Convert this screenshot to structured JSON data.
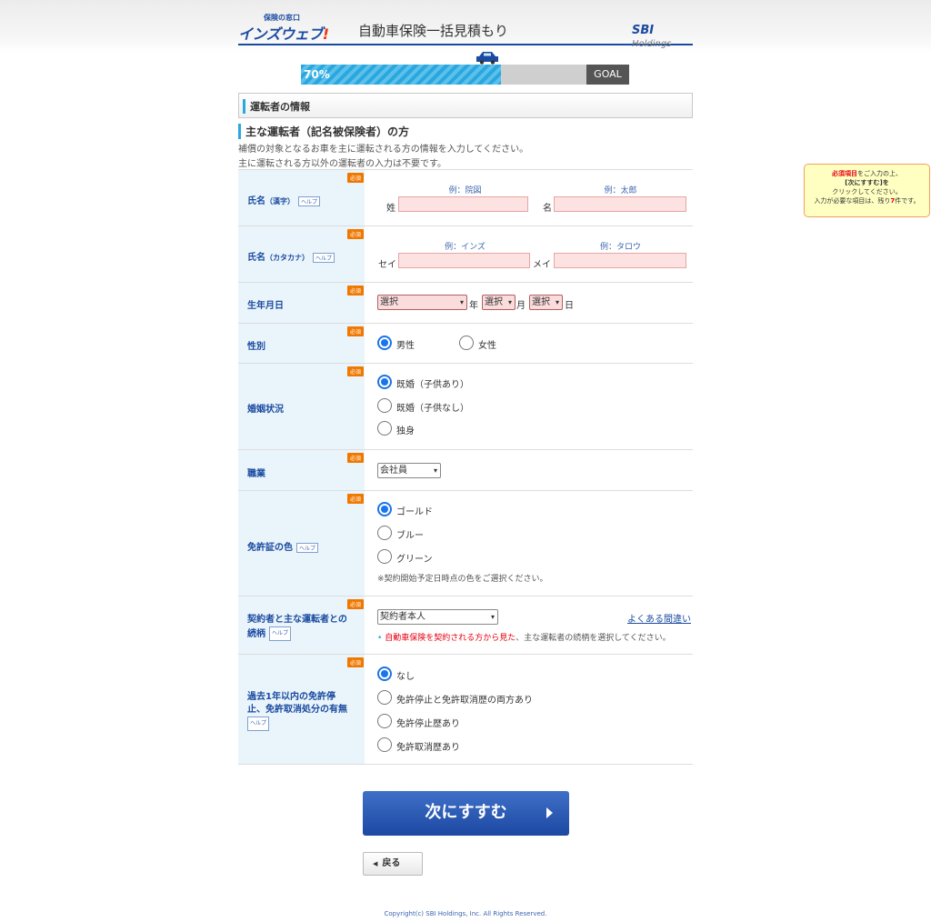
{
  "header": {
    "logo_small": "保険の窓口",
    "logo_main": "インズウェブ",
    "logo_mark": "!",
    "title": "自動車保険一括見積もり",
    "sbi_brand": "SBI",
    "sbi_holdings": "Holdings"
  },
  "progress": {
    "percent_label": "70%",
    "value_fraction": 0.7,
    "goal_label": "GOAL",
    "color": "#2aa7df"
  },
  "section_title": "運転者の情報",
  "subsection": {
    "title": "主な運転者（記名被保険者）の方",
    "desc_line1": "補償の対象となるお車を主に運転される方の情報を入力してください。",
    "desc_line2": "主に運転される方以外の運転者の入力は不要です。"
  },
  "required_badge": "必須",
  "help_badge": "ヘルプ",
  "fields": {
    "name_kanji": {
      "label": "氏名",
      "label_note": "（漢字）",
      "last_prefix": "姓",
      "last_example": "例：院図",
      "first_prefix": "名",
      "first_example": "例：太郎"
    },
    "name_kana": {
      "label": "氏名",
      "label_note": "（カタカナ）",
      "last_prefix": "セイ",
      "last_example": "例：インズ",
      "first_prefix": "メイ",
      "first_example": "例：タロウ"
    },
    "birthdate": {
      "label": "生年月日",
      "year_value": "選択",
      "year_unit": "年",
      "month_value": "選択",
      "month_unit": "月",
      "day_value": "選択",
      "day_unit": "日"
    },
    "gender": {
      "label": "性別",
      "options": [
        "男性",
        "女性"
      ],
      "selected": "男性"
    },
    "marital": {
      "label": "婚姻状況",
      "options": [
        "既婚（子供あり）",
        "既婚（子供なし）",
        "独身"
      ],
      "selected": "既婚（子供あり）"
    },
    "occupation": {
      "label": "職業",
      "value": "会社員"
    },
    "license_color": {
      "label": "免許証の色",
      "options": [
        "ゴールド",
        "ブルー",
        "グリーン"
      ],
      "selected": "ゴールド",
      "note": "※契約開始予定日時点の色をご選択ください。"
    },
    "relation": {
      "label_line1": "契約者と主な運転者との",
      "label_line2": "続柄",
      "value": "契約者本人",
      "faq_link": "よくある間違い",
      "note_bullet": "•",
      "note_red": "自動車保険を契約される方から見た",
      "note_rest": "、主な運転者の続柄を選択してください。"
    },
    "suspension": {
      "label_line1": "過去1年以内の免許停",
      "label_line2": "止、免許取消処分の有無",
      "options": [
        "なし",
        "免許停止と免許取消歴の両方あり",
        "免許停止歴あり",
        "免許取消歴あり"
      ],
      "selected": "なし"
    }
  },
  "side_notice": {
    "line1_red": "必須項目",
    "line1_rest": "をご入力の上、",
    "line2": "[次にすすむ]を",
    "line3": "クリックしてください。",
    "line4_pre": "入力が必要な項目は、残り",
    "line4_count": "7",
    "line4_post": "件です。"
  },
  "buttons": {
    "next": "次にすすむ",
    "back": "戻る"
  },
  "footer": "Copyright(c) SBI Holdings, Inc. All Rights Reserved.",
  "colors": {
    "brand": "#1a4ba0",
    "required": "#f07800",
    "input_error_bg": "#fde2e2",
    "accent": "#2aa7df"
  }
}
